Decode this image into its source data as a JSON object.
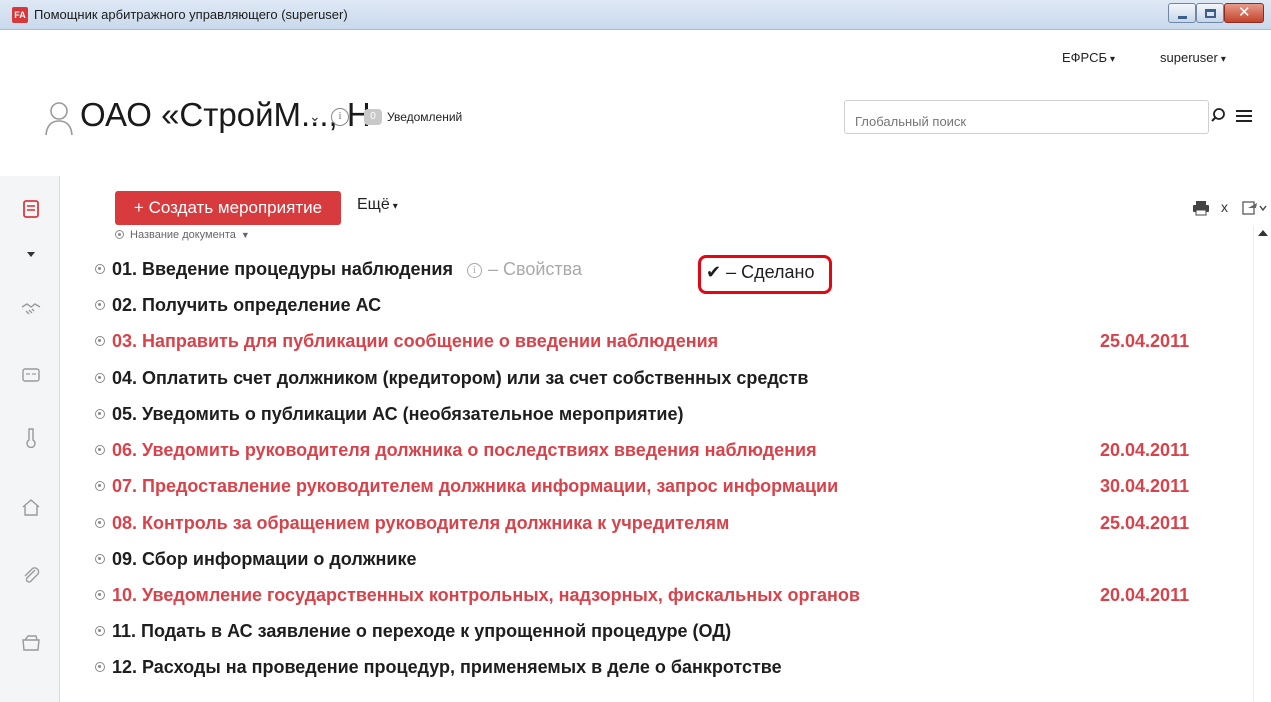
{
  "window": {
    "title": "Помощник арбитражного управляющего (superuser)",
    "app_icon": "FA"
  },
  "header": {
    "efrsb_label": "ЕФРСБ",
    "user_label": "superuser",
    "company": "ОАО «СтройМ..., Н",
    "notifications_count": "0",
    "notifications_label": "Уведомлений",
    "search_placeholder": "Глобальный поиск"
  },
  "toolbar": {
    "create_label": "+ Создать мероприятие",
    "more_label": "Ещё",
    "close_label": "x"
  },
  "list": {
    "column_header": "Название документа",
    "properties_label": "– Свойства",
    "done_label": "✔ – Сделано",
    "rows": [
      {
        "title": "01. Введение процедуры наблюдения",
        "date": "",
        "overdue": false
      },
      {
        "title": "02. Получить определение АС",
        "date": "",
        "overdue": false
      },
      {
        "title": "03. Направить для публикации сообщение о введении наблюдения",
        "date": "25.04.2011",
        "overdue": true
      },
      {
        "title": "04. Оплатить счет должником (кредитором) или за счет собственных средств",
        "date": "",
        "overdue": false
      },
      {
        "title": "05. Уведомить о публикации АС (необязательное мероприятие)",
        "date": "",
        "overdue": false
      },
      {
        "title": "06. Уведомить руководителя должника о последствиях введения наблюдения",
        "date": "20.04.2011",
        "overdue": true
      },
      {
        "title": "07. Предоставление руководителем должника информации, запрос информации",
        "date": "30.04.2011",
        "overdue": true
      },
      {
        "title": "08. Контроль за обращением руководителя должника к учредителям",
        "date": "25.04.2011",
        "overdue": true
      },
      {
        "title": "09. Сбор информации о должнике",
        "date": "",
        "overdue": false
      },
      {
        "title": "10. Уведомление государственных контрольных, надзорных, фискальных органов",
        "date": "20.04.2011",
        "overdue": true
      },
      {
        "title": "11. Подать в АС заявление о переходе к упрощенной процедуре (ОД)",
        "date": "",
        "overdue": false
      },
      {
        "title": "12. Расходы на проведение процедур, применяемых в деле о банкротстве",
        "date": "",
        "overdue": false
      }
    ]
  },
  "colors": {
    "accent": "#d83b3e",
    "overdue": "#d8434b",
    "highlight": "#e30613",
    "sidebar_active": "#d83b3e"
  },
  "sidebar": {
    "icons": [
      "document-icon",
      "chevron-down-icon",
      "handshake-icon",
      "id-card-icon",
      "thermometer-icon",
      "home-icon",
      "paperclip-icon",
      "wallet-icon"
    ]
  }
}
